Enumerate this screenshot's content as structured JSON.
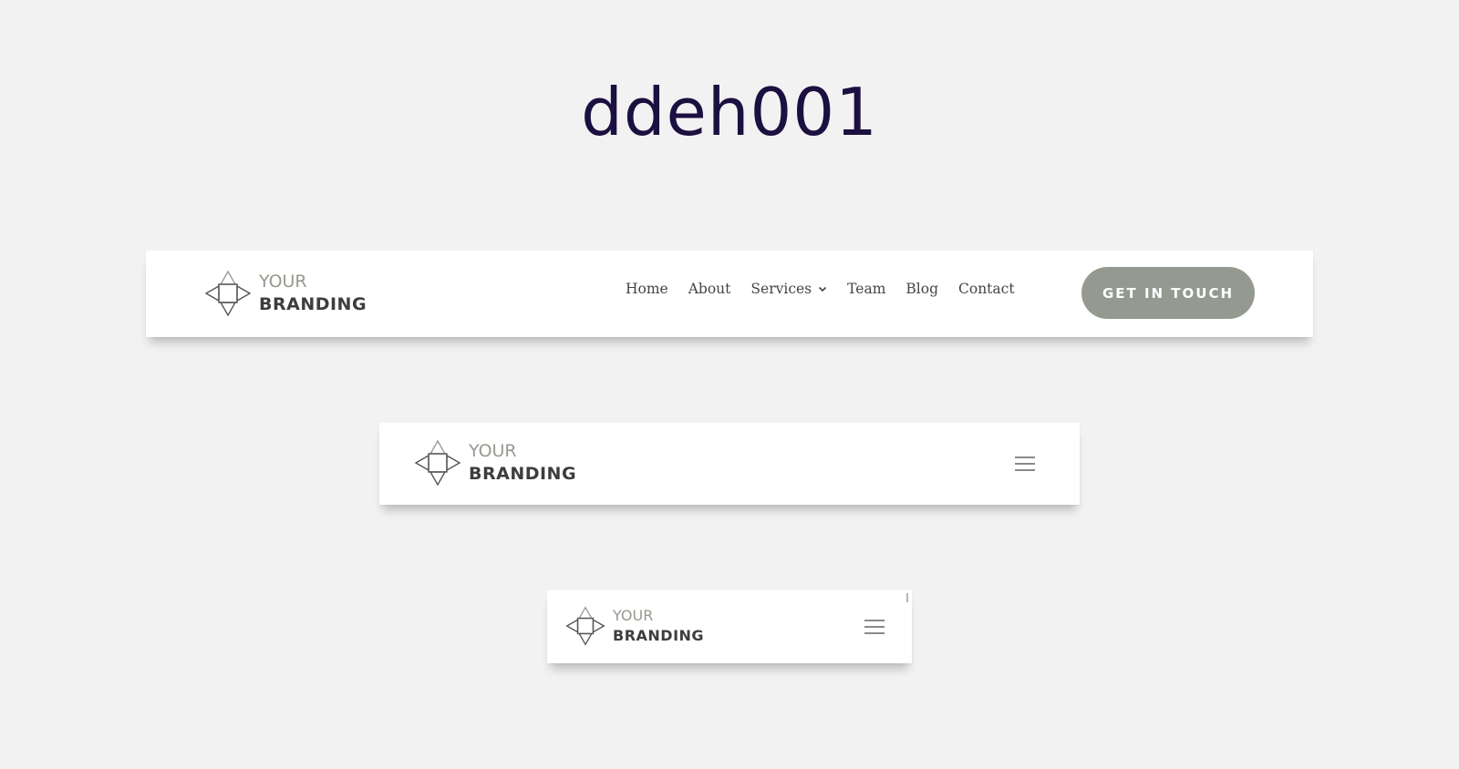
{
  "page": {
    "title": "ddeh001"
  },
  "logo": {
    "line1": "YOUR",
    "line2": "BRANDING",
    "icon": "diamond-compass-icon"
  },
  "desktop_header": {
    "nav": [
      {
        "label": "Home"
      },
      {
        "label": "About"
      },
      {
        "label": "Services",
        "has_dropdown": true
      },
      {
        "label": "Team"
      },
      {
        "label": "Blog"
      },
      {
        "label": "Contact"
      }
    ],
    "cta_label": "GET IN TOUCH"
  },
  "tablet_header": {
    "menu_icon": "hamburger-menu-icon"
  },
  "mobile_header": {
    "menu_icon": "hamburger-menu-icon"
  },
  "colors": {
    "background": "#f2f2f2",
    "title": "#1b1040",
    "accent": "#949a8f",
    "logo_dark": "#3d3d3d",
    "nav_text": "#444444"
  }
}
